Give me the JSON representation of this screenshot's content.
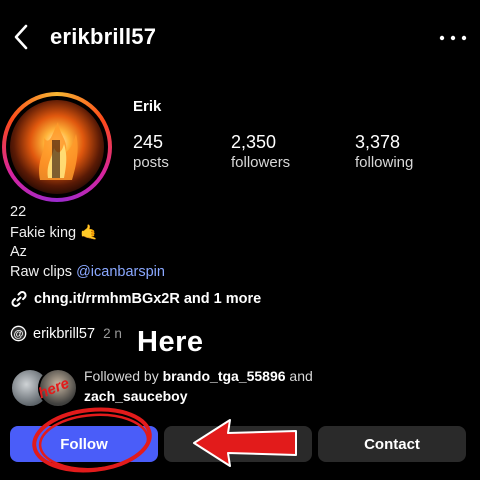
{
  "header": {
    "username": "erikbrill57",
    "back_icon": "chevron-left-icon",
    "more_icon": "ellipsis-icon"
  },
  "profile": {
    "display_name": "Erik",
    "stats": [
      {
        "value": "245",
        "label": "posts"
      },
      {
        "value": "2,350",
        "label": "followers"
      },
      {
        "value": "3,378",
        "label": "following"
      }
    ],
    "bio": {
      "line1": "22",
      "line2": "Fakie king 🤙",
      "line3": "Az",
      "line4_prefix": "Raw clips ",
      "line4_mention": "@icanbarspin"
    },
    "link": {
      "icon": "link-icon",
      "text": "chng.it/rrmhmBGx2R and 1 more"
    },
    "threads": {
      "icon": "threads-icon",
      "handle": "erikbrill57",
      "suffix": "2 n"
    },
    "followed_by": {
      "prefix": "Followed by ",
      "user1": "brando_tga_55896",
      "joiner": " and",
      "user2": "zach_sauceboy"
    }
  },
  "actions": {
    "follow": "Follow",
    "message": "",
    "contact": "Contact"
  },
  "annotations": {
    "overlay_text": "Here",
    "red_text": "here",
    "red_color": "#e21b1b"
  },
  "colors": {
    "follow_button": "#4a5df9",
    "secondary_button": "#2a2a2a",
    "mention": "#8aa8ff"
  }
}
